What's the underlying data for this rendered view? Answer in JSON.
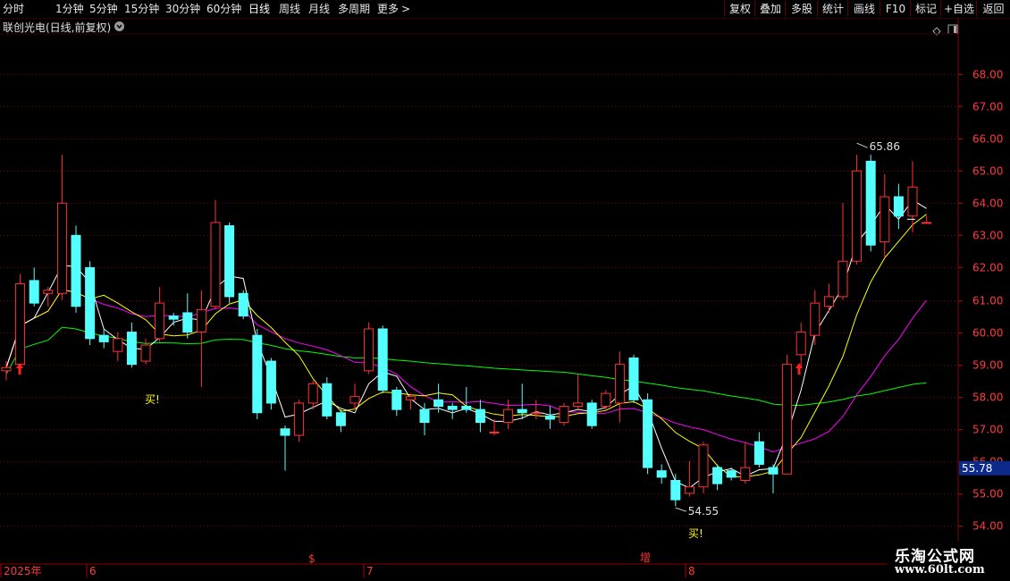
{
  "toolbar": {
    "periods": [
      "分时",
      "1分钟",
      "5分钟",
      "15分钟",
      "30分钟",
      "60分钟",
      "日线",
      "周线",
      "月线",
      "多周期",
      "更多"
    ],
    "active_period": "日线",
    "more_arrow": ">",
    "actions": [
      "复权",
      "叠加",
      "多股",
      "统计",
      "画线",
      "F10",
      "标记",
      "+自选",
      "返回"
    ]
  },
  "stock": {
    "title": "联创光电(日线,前复权)"
  },
  "chart_data": {
    "type": "candlestick",
    "price_axis": {
      "ticks": [
        "68.00",
        "67.00",
        "66.00",
        "65.00",
        "64.00",
        "63.00",
        "62.00",
        "61.00",
        "60.00",
        "59.00",
        "58.00",
        "57.00",
        "56.00",
        "55.00",
        "54.00"
      ],
      "range": [
        53.7,
        68.7
      ],
      "current_price": "55.78"
    },
    "time_axis": {
      "labels": [
        "2025年",
        "6",
        "7",
        "8"
      ],
      "markers": [
        "$",
        "增"
      ]
    },
    "candles": [
      [
        58.8,
        58.9,
        59.1,
        58.5
      ],
      [
        59.0,
        61.5,
        61.8,
        58.8
      ],
      [
        61.6,
        60.9,
        62.0,
        60.8
      ],
      [
        61.2,
        61.3,
        61.4,
        60.8
      ],
      [
        61.2,
        64.0,
        65.5,
        61.0
      ],
      [
        63.0,
        60.8,
        63.3,
        60.6
      ],
      [
        62.0,
        59.8,
        62.2,
        59.6
      ],
      [
        59.9,
        59.7,
        60.1,
        59.5
      ],
      [
        59.4,
        59.8,
        60.0,
        59.1
      ],
      [
        60.0,
        59.0,
        60.3,
        58.9
      ],
      [
        59.1,
        59.6,
        59.8,
        59.0
      ],
      [
        59.8,
        60.9,
        61.4,
        59.7
      ],
      [
        60.5,
        60.4,
        60.6,
        60.2
      ],
      [
        60.6,
        60.0,
        61.2,
        59.8
      ],
      [
        60.0,
        60.7,
        61.3,
        58.3
      ],
      [
        60.8,
        63.4,
        64.1,
        60.7
      ],
      [
        63.3,
        61.1,
        63.4,
        60.9
      ],
      [
        61.2,
        60.5,
        61.3,
        60.4
      ],
      [
        59.9,
        57.5,
        60.1,
        57.3
      ],
      [
        59.1,
        57.8,
        59.2,
        57.6
      ],
      [
        57.0,
        56.8,
        57.1,
        55.7
      ],
      [
        56.8,
        57.8,
        57.9,
        56.6
      ],
      [
        57.8,
        58.4,
        58.5,
        57.6
      ],
      [
        58.4,
        57.4,
        58.6,
        57.3
      ],
      [
        57.5,
        57.1,
        57.6,
        56.9
      ],
      [
        57.8,
        58.0,
        58.4,
        57.6
      ],
      [
        58.8,
        60.1,
        60.3,
        58.7
      ],
      [
        60.1,
        58.2,
        60.2,
        58.1
      ],
      [
        58.2,
        57.6,
        58.3,
        57.4
      ],
      [
        57.9,
        58.0,
        58.1,
        57.6
      ],
      [
        57.6,
        57.2,
        57.8,
        56.8
      ],
      [
        57.9,
        57.7,
        58.4,
        57.5
      ],
      [
        57.7,
        57.6,
        57.8,
        57.3
      ],
      [
        57.7,
        57.6,
        58.3,
        57.5
      ],
      [
        57.6,
        57.2,
        57.9,
        56.9
      ],
      [
        56.9,
        56.9,
        57.3,
        56.8
      ],
      [
        57.2,
        57.6,
        57.9,
        57.0
      ],
      [
        57.6,
        57.5,
        58.4,
        57.3
      ],
      [
        57.5,
        57.5,
        57.9,
        57.3
      ],
      [
        57.4,
        57.3,
        57.7,
        57.0
      ],
      [
        57.2,
        57.7,
        57.8,
        57.1
      ],
      [
        57.7,
        57.8,
        58.7,
        57.6
      ],
      [
        57.8,
        57.1,
        57.9,
        57.0
      ],
      [
        57.7,
        58.1,
        58.2,
        57.6
      ],
      [
        57.8,
        59.0,
        59.4,
        57.2
      ],
      [
        59.2,
        57.9,
        59.3,
        57.8
      ],
      [
        57.9,
        55.8,
        58.1,
        55.6
      ],
      [
        55.7,
        55.5,
        55.9,
        55.3
      ],
      [
        55.4,
        54.8,
        55.6,
        54.6
      ],
      [
        55.0,
        55.2,
        56.0,
        54.9
      ],
      [
        55.2,
        56.5,
        56.6,
        55.0
      ],
      [
        55.8,
        55.3,
        55.9,
        55.1
      ],
      [
        55.7,
        55.5,
        55.8,
        55.4
      ],
      [
        55.4,
        55.8,
        56.6,
        55.3
      ],
      [
        56.6,
        55.9,
        56.9,
        55.8
      ],
      [
        55.8,
        55.6,
        55.9,
        55.0
      ],
      [
        55.6,
        59.0,
        59.3,
        55.6
      ],
      [
        59.3,
        60.0,
        60.3,
        58.9
      ],
      [
        59.9,
        60.9,
        61.3,
        59.6
      ],
      [
        60.8,
        61.1,
        61.5,
        60.6
      ],
      [
        61.1,
        62.2,
        64.0,
        61.0
      ],
      [
        62.2,
        65.0,
        65.5,
        62.1
      ],
      [
        65.3,
        62.7,
        65.5,
        62.5
      ],
      [
        62.8,
        64.2,
        64.9,
        62.3
      ],
      [
        64.2,
        63.6,
        64.6,
        63.2
      ],
      [
        63.6,
        64.5,
        65.3,
        63.1
      ],
      [
        63.4,
        63.4,
        63.6,
        63.4
      ]
    ],
    "candle_dates_visible": false,
    "annotations": [
      {
        "text": "65.86",
        "kind": "high"
      },
      {
        "text": "54.55",
        "kind": "low"
      },
      {
        "text": "买!",
        "kind": "signal"
      },
      {
        "text": "买!",
        "kind": "signal"
      }
    ],
    "ma_colors": {
      "ma5": "#ffffff",
      "ma10": "#ffff00",
      "ma20": "#ff00ff",
      "ma60": "#00ff00"
    },
    "up_color": "#ff3232",
    "down_color": "#54ffff",
    "grid": true
  },
  "watermark": {
    "line1": "乐淘公式网",
    "line2": "www.60lt.com"
  }
}
